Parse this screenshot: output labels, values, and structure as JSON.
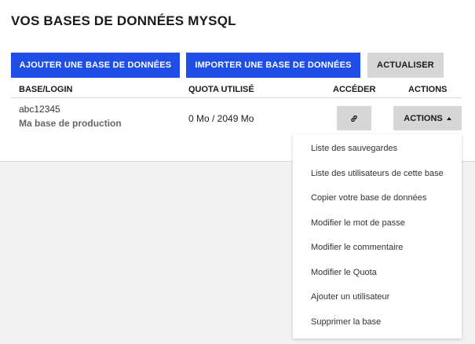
{
  "page": {
    "title": "VOS BASES DE DONNÉES MYSQL"
  },
  "toolbar": {
    "add_label": "AJOUTER UNE BASE DE DONNÉES",
    "import_label": "IMPORTER UNE BASE DE DONNÉES",
    "refresh_label": "ACTUALISER"
  },
  "table": {
    "headers": {
      "base": "BASE/LOGIN",
      "quota": "QUOTA UTILISÉ",
      "access": "ACCÉDER",
      "actions": "ACTIONS"
    },
    "rows": [
      {
        "login": "abc12345",
        "description": "Ma base de production",
        "quota": "0 Mo / 2049 Mo",
        "access_icon": "link-icon",
        "actions_label": "ACTIONS"
      }
    ]
  },
  "actions_menu": {
    "items": [
      "Liste des sauvegardes",
      "Liste des utilisateurs de cette base",
      "Copier votre base de données",
      "Modifier le mot de passe",
      "Modifier le commentaire",
      "Modifier le Quota",
      "Ajouter un utilisateur",
      "Supprimer la base"
    ]
  },
  "colors": {
    "primary": "#1f4ee6",
    "secondary_button": "#d6d6d6",
    "background": "#f2f2f2"
  }
}
